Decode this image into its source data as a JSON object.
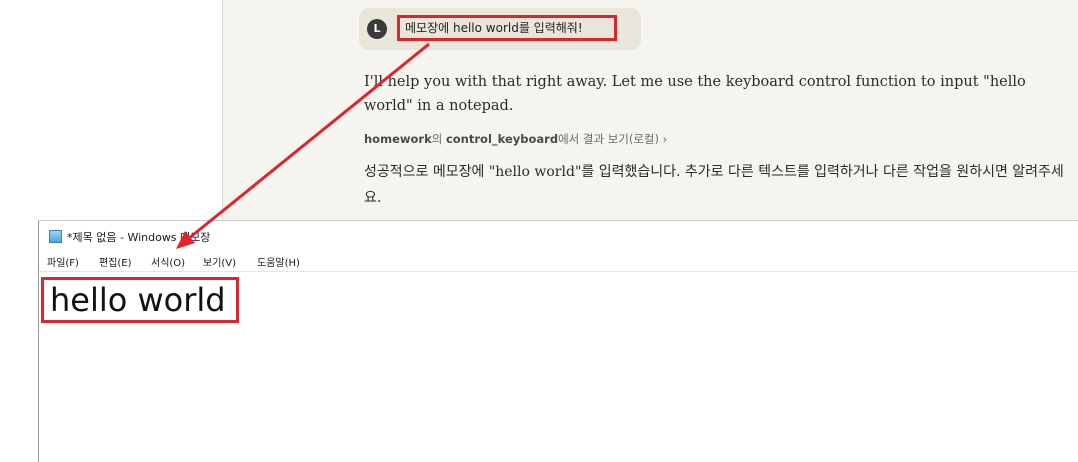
{
  "chat": {
    "avatar_letter": "L",
    "user_message": "메모장에 hello world를 입력해줘!",
    "reply_1": "I'll help you with that right away. Let me use the keyboard control function to input \"hello world\" in a notepad.",
    "tool_server": "homework",
    "tool_particle": "의 ",
    "tool_name": "control_keyboard",
    "tool_suffix": "에서 결과 보기(로컬)",
    "tool_chevron": "›",
    "reply_2": "성공적으로 메모장에 \"hello world\"를 입력했습니다. 추가로 다른 텍스트를 입력하거나 다른 작업을 원하시면 알려주세요."
  },
  "notepad": {
    "title": "*제목 없음 - Windows 메모장",
    "icon": "notepad-icon",
    "menu": [
      "파일(F)",
      "편집(E)",
      "서식(O)",
      "보기(V)",
      "도움말(H)"
    ],
    "content": "hello world"
  },
  "colors": {
    "highlight": "#e0242b",
    "chat_bg": "#f5f4ef",
    "bubble_bg": "#e9e6dc"
  }
}
